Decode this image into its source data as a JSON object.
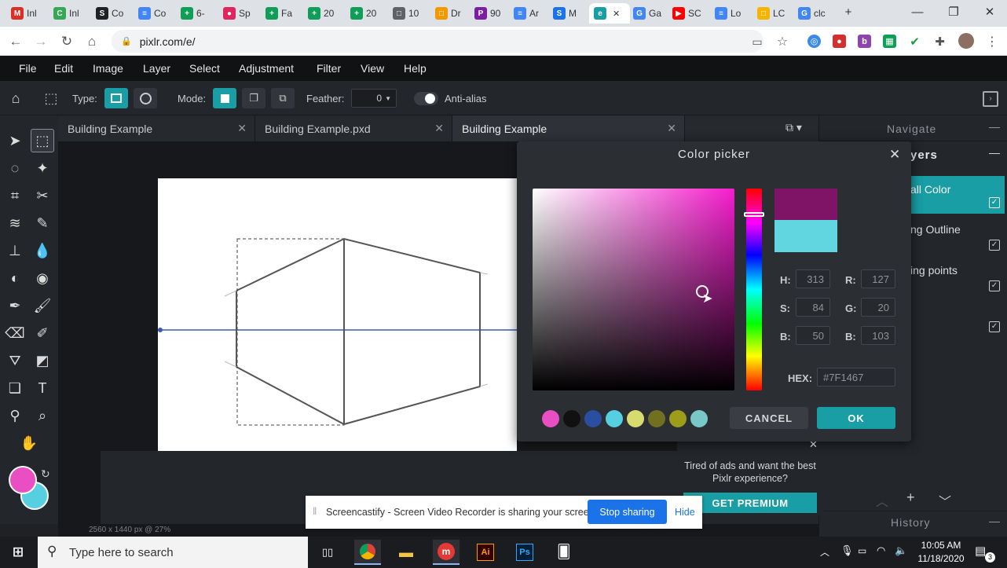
{
  "browser": {
    "tabs": [
      {
        "label": "Inl",
        "icon": "gmail-icon",
        "color": "#d93025",
        "glyph": "M"
      },
      {
        "label": "Inl",
        "icon": "classroom-icon",
        "color": "#34a853",
        "glyph": "C"
      },
      {
        "label": "Co",
        "icon": "s-icon",
        "color": "#202124",
        "glyph": "S"
      },
      {
        "label": "Co",
        "icon": "docs-icon",
        "color": "#4285f4",
        "glyph": "≡"
      },
      {
        "label": "6-",
        "icon": "sheets-icon",
        "color": "#0f9d58",
        "glyph": "+"
      },
      {
        "label": "Sp",
        "icon": "spotify-icon",
        "color": "#e0245e",
        "glyph": "●"
      },
      {
        "label": "Fa",
        "icon": "sheets-icon",
        "color": "#0f9d58",
        "glyph": "+"
      },
      {
        "label": "20",
        "icon": "sheets-icon",
        "color": "#0f9d58",
        "glyph": "+"
      },
      {
        "label": "20",
        "icon": "sheets-icon",
        "color": "#0f9d58",
        "glyph": "+"
      },
      {
        "label": "10",
        "icon": "page-icon",
        "color": "#5f6368",
        "glyph": "□"
      },
      {
        "label": "Dr",
        "icon": "orange-icon",
        "color": "#f29900",
        "glyph": "□"
      },
      {
        "label": "90",
        "icon": "p-icon",
        "color": "#7b1fa2",
        "glyph": "P"
      },
      {
        "label": "Ar",
        "icon": "docs-icon",
        "color": "#4285f4",
        "glyph": "≡"
      },
      {
        "label": "M",
        "icon": "sm-icon",
        "color": "#1a73e8",
        "glyph": "S"
      },
      {
        "label": "",
        "icon": "pixlr-icon",
        "color": "#199ea6",
        "glyph": "e",
        "active": true
      },
      {
        "label": "Ga",
        "icon": "google-icon",
        "color": "#4285f4",
        "glyph": "G"
      },
      {
        "label": "SC",
        "icon": "youtube-icon",
        "color": "#ff0000",
        "glyph": "▶"
      },
      {
        "label": "Lo",
        "icon": "docs-icon",
        "color": "#4285f4",
        "glyph": "≡"
      },
      {
        "label": "LC",
        "icon": "slides-icon",
        "color": "#f4b400",
        "glyph": "□"
      },
      {
        "label": "clc",
        "icon": "google-icon",
        "color": "#4285f4",
        "glyph": "G"
      }
    ],
    "url": "pixlr.com/e/"
  },
  "menu": [
    "File",
    "Edit",
    "Image",
    "Layer",
    "Select",
    "Adjustment",
    "Filter",
    "View",
    "Help"
  ],
  "options": {
    "type_label": "Type:",
    "mode_label": "Mode:",
    "feather_label": "Feather:",
    "feather_value": "0",
    "antialias_label": "Anti-alias"
  },
  "doc_tabs": [
    {
      "label": "Building Example",
      "active": false
    },
    {
      "label": "Building Example.pxd",
      "active": false
    },
    {
      "label": "Building Example",
      "active": true
    }
  ],
  "status": "2560 x 1440 px @ 27%",
  "right_panel": {
    "navigate": "Navigate",
    "layers": "yers",
    "layer_items": [
      "all Color",
      "ng Outline",
      "ing points",
      ""
    ],
    "history": "History",
    "ad_text": "Tired of ads and want the best Pixlr experience?",
    "premium": "GET PREMIUM"
  },
  "picker": {
    "title": "Color picker",
    "new_color": "#7F1467",
    "old_color": "#62d6e0",
    "H": "313",
    "S": "84",
    "B": "50",
    "R": "127",
    "G": "20",
    "Bv": "103",
    "hex": "#7F1467",
    "swatches": [
      "#e94fc2",
      "#111111",
      "#2b4fa0",
      "#56cfe0",
      "#d8dc6f",
      "#717020",
      "#9d9d1c",
      "#78c8c8"
    ],
    "cancel": "CANCEL",
    "ok": "OK"
  },
  "sharing": {
    "text": "Screencastify - Screen Video Recorder is sharing your screen.",
    "stop": "Stop sharing",
    "hide": "Hide"
  },
  "colors": {
    "fg": "#e94fc2",
    "bg": "#56cfe0"
  },
  "taskbar": {
    "search": "Type here to search",
    "time": "10:05 AM",
    "date": "11/18/2020",
    "notif": "3"
  }
}
